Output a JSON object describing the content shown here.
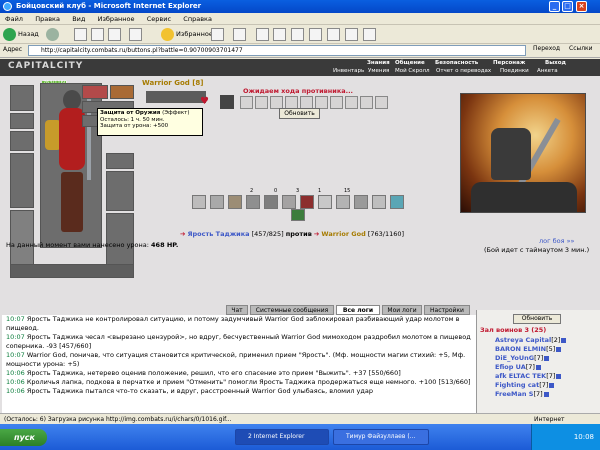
{
  "window": {
    "title": "Бойцовский клуб - Microsoft Internet Explorer",
    "minimize": "_",
    "maximize": "□",
    "close": "×"
  },
  "menu": [
    "Файл",
    "Правка",
    "Вид",
    "Избранное",
    "Сервис",
    "Справка"
  ],
  "toolbar": {
    "back_label": "Назад",
    "favorites_label": "Избранное"
  },
  "address": {
    "label": "Адрес",
    "url": "http://capitalcity.combats.ru/buttons.pl?battle=0.90700903701477",
    "go_label": "Переход",
    "links_label": "Ссылки"
  },
  "site": {
    "logo": "CAPITALCITY",
    "nav_tabs": [
      "Знания",
      "Общение",
      "Безопасность",
      "Персонаж",
      "Выход"
    ],
    "nav_links": [
      "Инвентарь",
      "Умения",
      "Мой Скролл",
      "Отчет о переводах",
      "Поединки",
      "Анкета"
    ]
  },
  "battle": {
    "my_hp_label": "763/1160",
    "opponent_name": "Warrior God [8]",
    "tooltip": {
      "title": "Защита от Оружия",
      "effect": "(Эффект)",
      "line1": "Осталось: 1 ч. 50 мин.",
      "line2": "Защита от урона: +500"
    },
    "waiting": "Ожидаем хода противника...",
    "refresh_label": "Обновить",
    "action_counts": [
      "2",
      "0",
      "3",
      "1",
      "15"
    ],
    "fighter1": "Ярость Таджика",
    "fighter1_hp": "[457/825]",
    "vs": "против",
    "fighter2": "Warrior God",
    "fighter2_hp": "[763/1160]",
    "damage_text": "На данный момент вами нанесено урона:",
    "damage_value": "468 HP.",
    "log_link": "лог боя »»",
    "timeout_text": "(Бой идет с таймаутом 3 мин.)"
  },
  "chat_tabs": [
    "Чат",
    "Системные сообщения",
    "Все логи",
    "Мои логи",
    "Настройки"
  ],
  "log_lines": [
    {
      "ts": "10:07",
      "text": "Ярость Таджика не контролировал ситуацию, и потому задумчивый Warrior God заблокировал разбивающий удар молотом в пищевод."
    },
    {
      "ts": "10:07",
      "text": "Ярость Таджика чесал <вырезано цензурой>, но вдруг, бесчувственный Warrior God мимоходом раздробил молотом в пищевод соперника. -93 [457/660]"
    },
    {
      "ts": "10:07",
      "text": "Warrior God, поничав, что ситуация становится критической, применил прием \"Ярость\". (Мф. мощности магии стихий: +5, Мф. мощности урона: +5)"
    },
    {
      "ts": "10:06",
      "text": "Ярость Таджика, нетерево оценив положение, решил, что его спасение это прием \"Выжить\". +37 [550/660]"
    },
    {
      "ts": "10:06",
      "text": "Кроличья лапка, подкова в перчатке и прием \"Отменить\" помогли Ярость Таджика продержаться еще немного. +100 [513/660]"
    },
    {
      "ts": "10:06",
      "text": "Ярость Таджика пытался что-то сказать, и вдруг, расстроенный Warrior God улыбаясь, вломил удар"
    }
  ],
  "right_panel": {
    "refresh_label": "Обновить",
    "room_title": "Зал воинов 3 (25)",
    "players": [
      {
        "name": "Astreya Capital",
        "level": "[2]"
      },
      {
        "name": "BARON ELMIN",
        "level": "[5]"
      },
      {
        "name": "DiE_YoUnG",
        "level": "[7]"
      },
      {
        "name": "Efiop UA",
        "level": "[7]"
      },
      {
        "name": "afk ELTAC TEK",
        "level": "[7]"
      },
      {
        "name": "Fighting cat",
        "level": "[7]"
      },
      {
        "name": "FreeMan S",
        "level": "[7]"
      }
    ]
  },
  "statusbar": {
    "text": "(Осталось: 6) Загрузка рисунка http://img.combats.ru/i/chars/0/1016.gif...",
    "zone": "Интернет"
  },
  "taskbar": {
    "start_label": "пуск",
    "tasks": [
      "2 Internet Explorer",
      "Тимур Файзуллаев (..."
    ],
    "clock": "10:08"
  },
  "colors": {
    "accent_blue": "#3d58c7",
    "warrior_gold": "#a67b00",
    "alert_red": "#c0172f",
    "timestamp_green": "#0a7d3b"
  }
}
